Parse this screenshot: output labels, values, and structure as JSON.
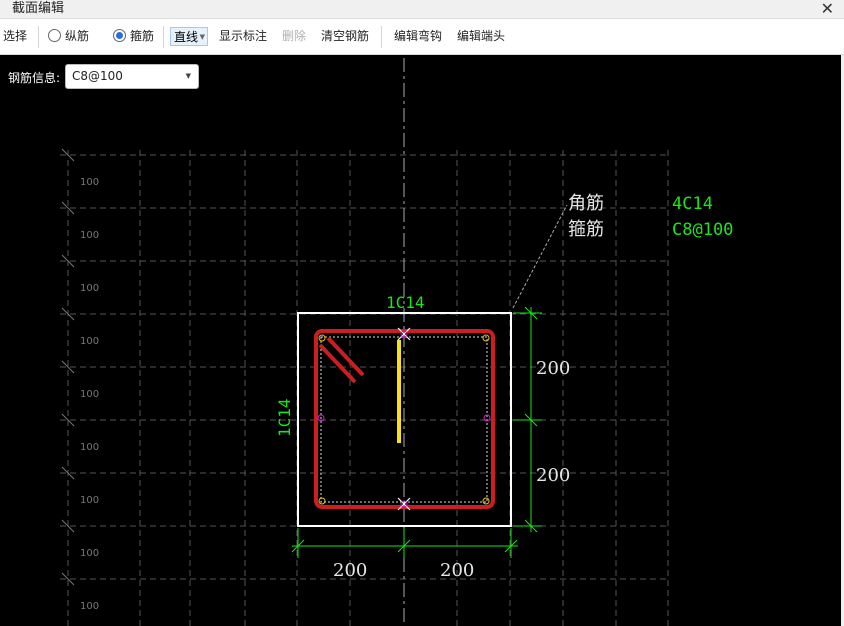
{
  "window": {
    "title": "截面编辑",
    "close_glyph": "✕"
  },
  "toolbar": {
    "select": "选择",
    "longitudinal": "纵筋",
    "stirrup": "箍筋",
    "line_mode": "直线",
    "show_annotation": "显示标注",
    "delete": "删除",
    "clear_rebar": "清空钢筋",
    "edit_hook": "编辑弯钩",
    "edit_end": "编辑端头"
  },
  "rebar_info": {
    "label": "钢筋信息:",
    "value": "C8@100"
  },
  "drawing": {
    "grid_labels": [
      "100",
      "100",
      "100",
      "100",
      "100",
      "100",
      "100",
      "100",
      "100"
    ],
    "top_label": "1C14",
    "left_label": "1C14",
    "legend": {
      "corner_name": "角筋",
      "corner_value": "4C14",
      "stirrup_name": "箍筋",
      "stirrup_value": "C8@100"
    },
    "dims": {
      "right_upper": "200",
      "right_lower": "200",
      "bottom_left": "200",
      "bottom_right": "200"
    }
  },
  "colors": {
    "rebar_red": "#cc1e1e",
    "label_green": "#19e619",
    "selected_yellow": "#f5e11e",
    "grid": "#555555"
  }
}
